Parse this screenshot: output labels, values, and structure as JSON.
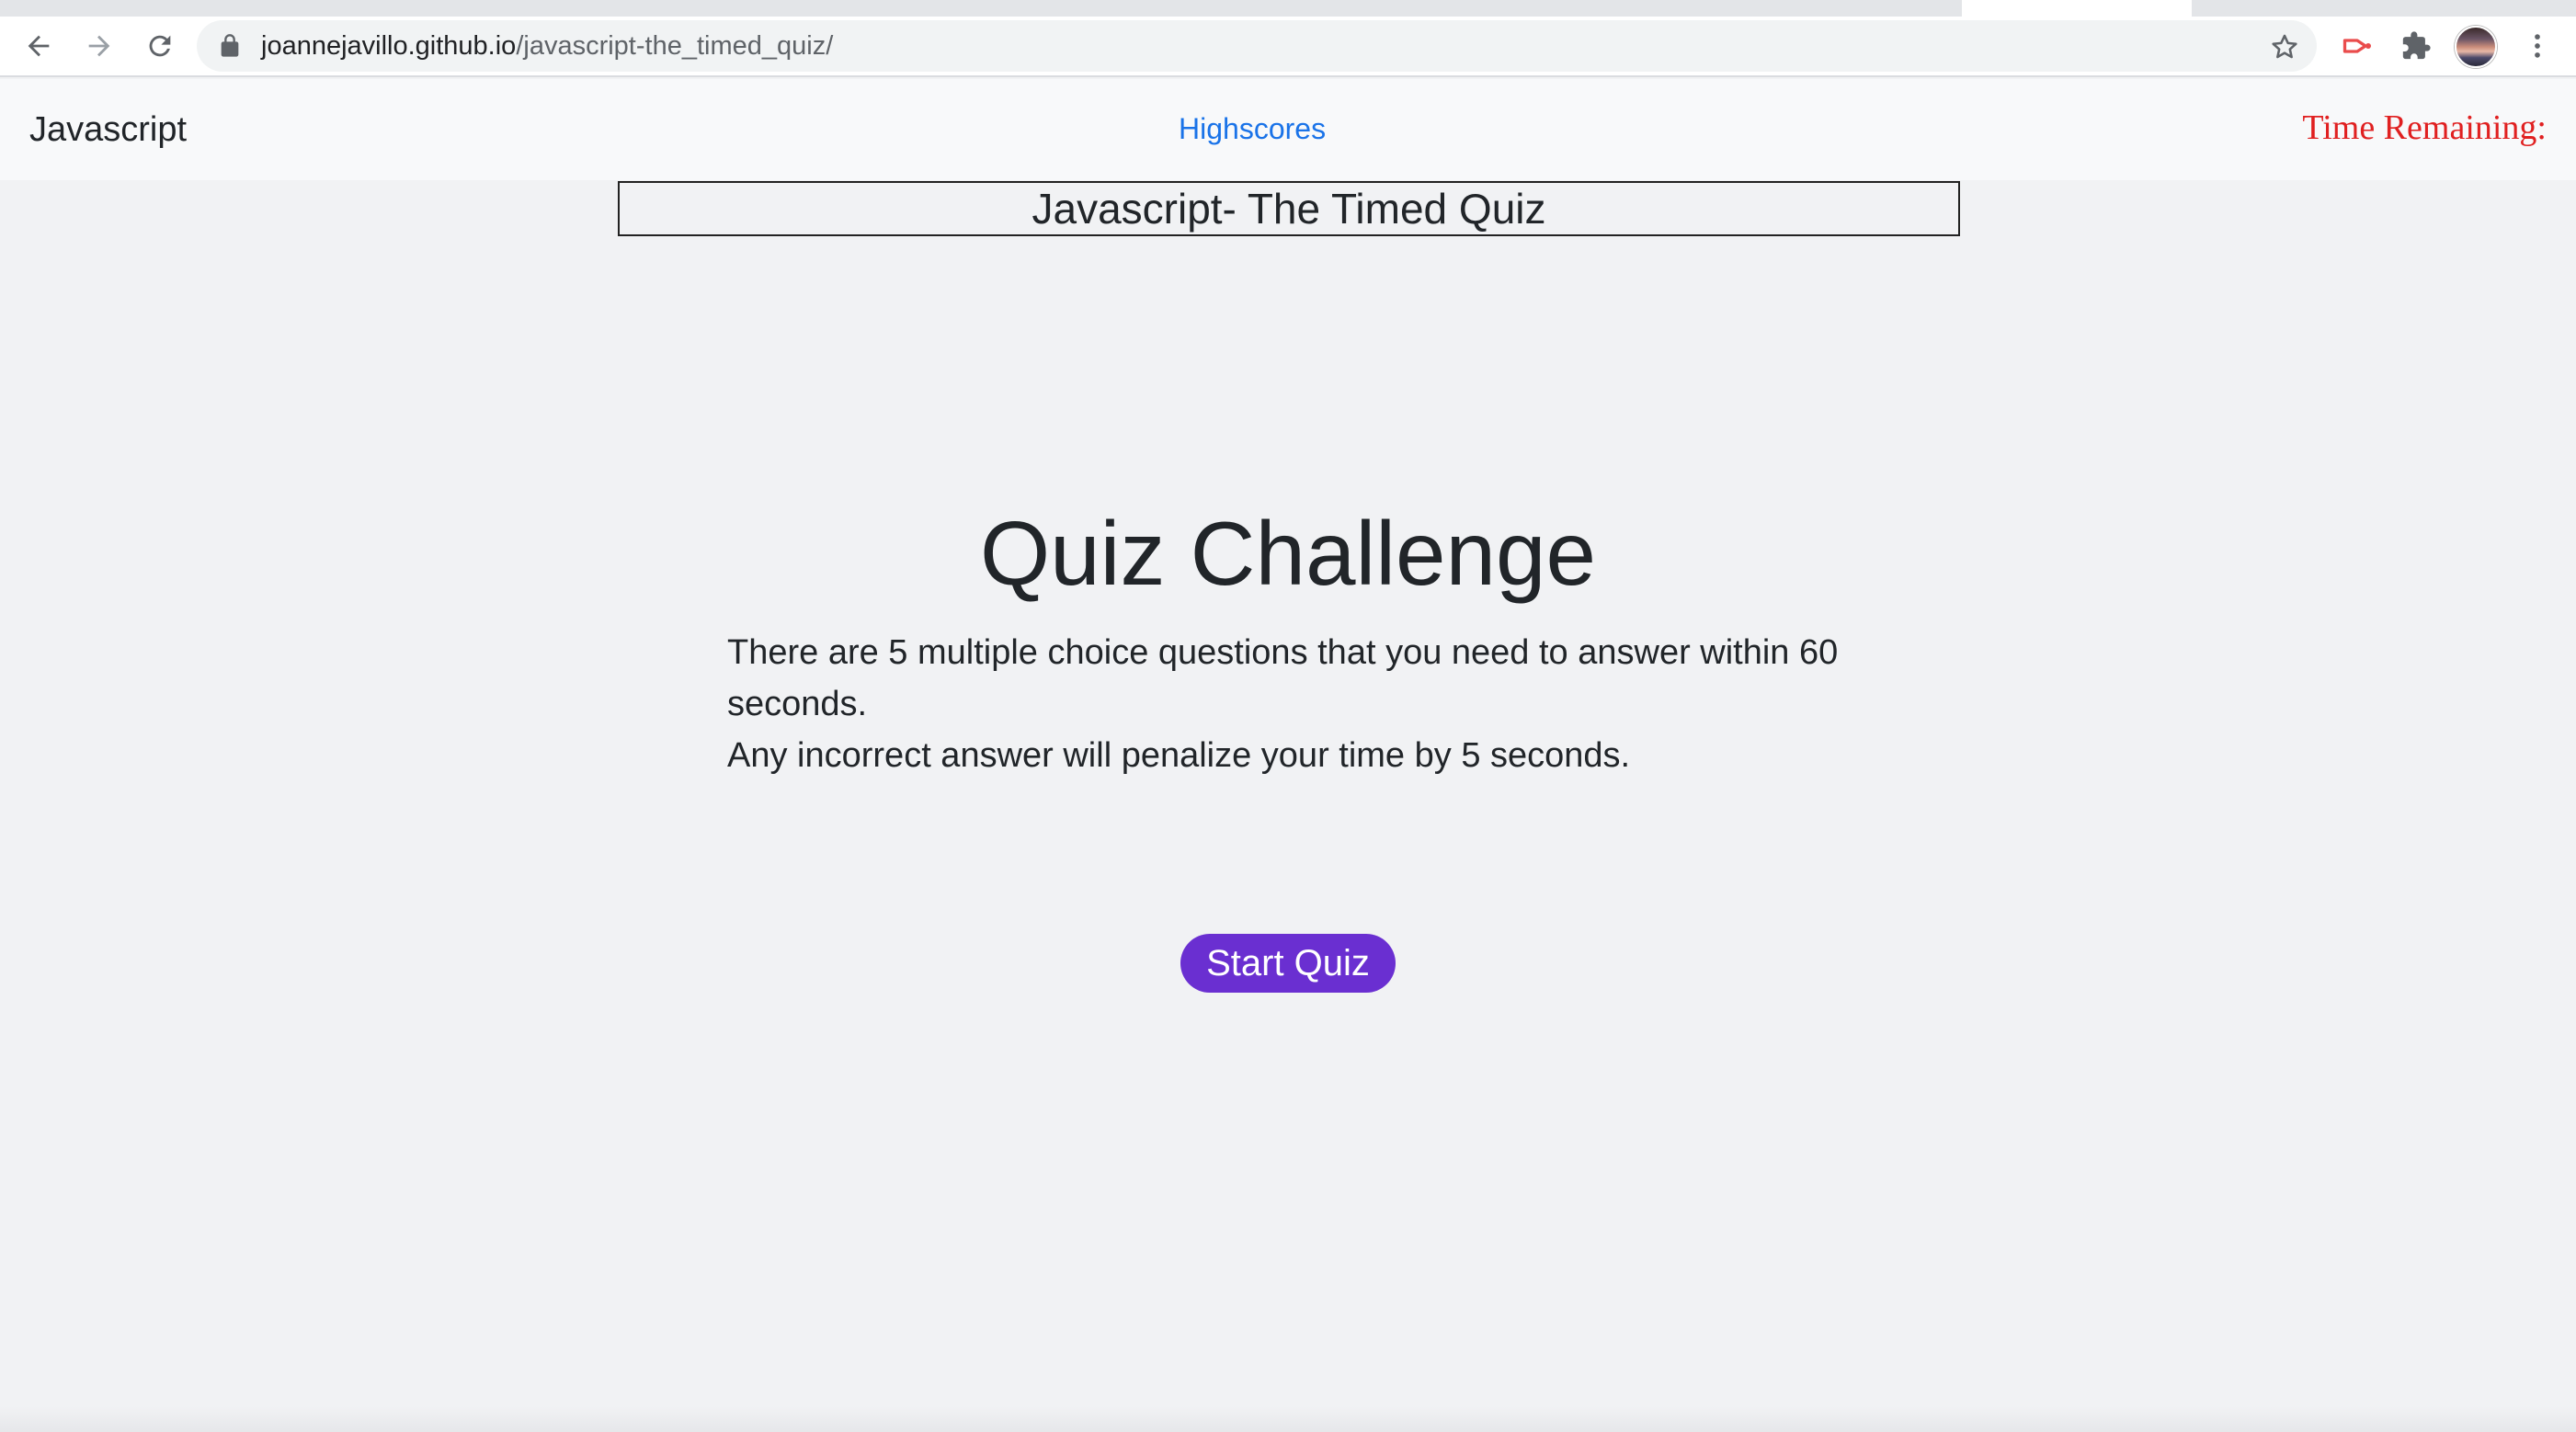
{
  "browser": {
    "url_host": "joannejavillo.github.io",
    "url_path": "/javascript-the_timed_quiz/",
    "icons": [
      "back-icon",
      "forward-icon",
      "reload-icon",
      "lock-icon",
      "bookmark-star-icon",
      "extension-cast-icon",
      "extensions-puzzle-icon",
      "profile-avatar",
      "more-menu-icon"
    ]
  },
  "navbar": {
    "brand": "Javascript",
    "highscores_link": "Highscores",
    "timer_label": "Time Remaining:"
  },
  "main": {
    "title_box": "Javascript- The Timed Quiz",
    "heading": "Quiz Challenge",
    "instructions_line1": "There are 5 multiple choice questions that you need to answer within 60 seconds.",
    "instructions_line2": "Any incorrect answer will penalize your time by 5 seconds.",
    "start_button": "Start Quiz"
  },
  "colors": {
    "timer": "#e02020",
    "link": "#1a73e8",
    "button": "#6a2fd1",
    "background": "#f1f2f4"
  }
}
